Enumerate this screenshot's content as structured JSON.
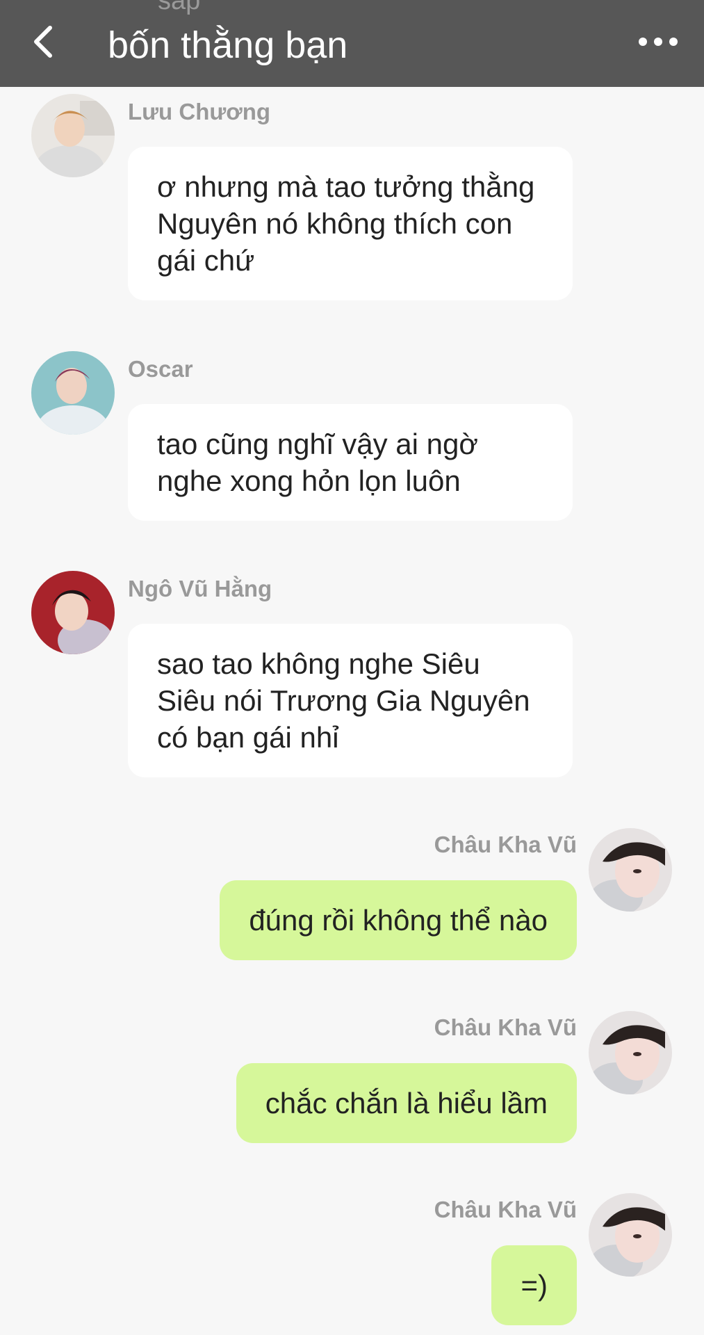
{
  "header": {
    "peek_text": "sáp",
    "title": "bốn thằng bạn"
  },
  "messages": [
    {
      "sender": "Lưu Chương",
      "text": "ơ nhưng mà tao tưởng thằng Nguyên nó không thích con gái chứ",
      "direction": "incoming"
    },
    {
      "sender": "Oscar",
      "text": "tao cũng nghĩ vậy ai ngờ nghe xong hỏn lọn luôn",
      "direction": "incoming"
    },
    {
      "sender": "Ngô Vũ Hằng",
      "text": "sao tao không nghe Siêu Siêu nói Trương Gia Nguyên có bạn gái nhỉ",
      "direction": "incoming"
    },
    {
      "sender": "Châu Kha Vũ",
      "text": "đúng rồi không thể nào",
      "direction": "outgoing"
    },
    {
      "sender": "Châu Kha Vũ",
      "text": "chắc chắn là hiểu lầm",
      "direction": "outgoing"
    },
    {
      "sender": "Châu Kha Vũ",
      "text": "=)",
      "direction": "outgoing"
    }
  ],
  "colors": {
    "header_bg": "#575757",
    "page_bg": "#f7f7f7",
    "incoming_bubble": "#ffffff",
    "outgoing_bubble": "#d6f79a",
    "sender_name": "#999999"
  },
  "icons": {
    "back": "chevron-left-icon",
    "more": "more-horizontal-icon"
  }
}
